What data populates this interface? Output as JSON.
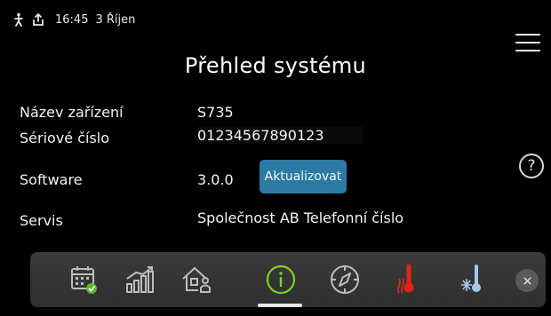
{
  "status_bar": {
    "icons": [
      "person-icon",
      "share-icon"
    ],
    "time": "16:45",
    "date": "3 Říjen"
  },
  "header": {
    "title": "Přehled systému"
  },
  "info": {
    "device_name_label": "Název zařízení",
    "device_name_value": "S735",
    "serial_label": "Sériové číslo",
    "serial_value": "01234567890123",
    "software_label": "Software",
    "software_value": "3.0.0",
    "update_button_label": "Aktualizovat",
    "service_label": "Servis",
    "service_value": "Společnost AB Telefonní číslo"
  },
  "help": {
    "glyph": "?"
  },
  "dock": {
    "items": [
      {
        "icon": "calendar-check-icon"
      },
      {
        "icon": "bar-chart-icon"
      },
      {
        "icon": "house-person-icon"
      },
      {
        "icon": "info-icon",
        "active": true
      },
      {
        "icon": "compass-icon"
      },
      {
        "icon": "heating-thermometer-icon",
        "accent": "#e2231a"
      },
      {
        "icon": "cooling-thermometer-icon",
        "accent": "#a6c8e8"
      }
    ],
    "close_icon": "close-icon"
  },
  "colors": {
    "background": "#000000",
    "dock": "#333333",
    "button": "#2c79a3",
    "active_icon": "#7dd321",
    "heating": "#e2231a",
    "cooling": "#a6c8e8"
  }
}
